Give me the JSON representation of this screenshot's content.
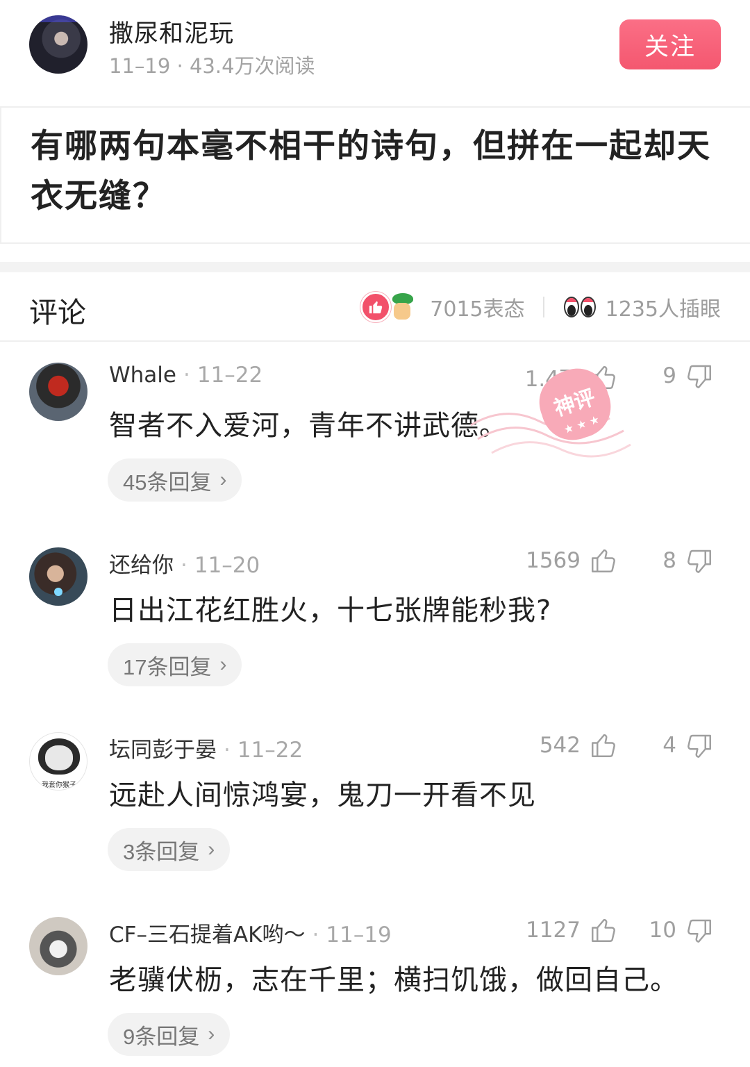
{
  "author": {
    "name": "撒尿和泥玩",
    "meta": "11–19 · 43.4万次阅读",
    "follow_label": "关注"
  },
  "question": {
    "title": "有哪两句本毫不相干的诗句，但拼在一起却天衣无缝？"
  },
  "comments_header": {
    "title": "评论",
    "reactions_count": "7015表态",
    "viewers_count": "1235人插眼"
  },
  "comments": [
    {
      "user": "Whale",
      "date": "11–22",
      "likes": "1.4万",
      "dislikes": "9",
      "text": "智者不入爱河，青年不讲武德。",
      "replies": "45条回复",
      "badge": "神评"
    },
    {
      "user": "还给你",
      "date": "11–20",
      "likes": "1569",
      "dislikes": "8",
      "text": "日出江花红胜火，十七张牌能秒我?",
      "replies": "17条回复"
    },
    {
      "user": "坛同彭于晏",
      "date": "11–22",
      "likes": "542",
      "dislikes": "4",
      "text": "远赴人间惊鸿宴，鬼刀一开看不见",
      "replies": "3条回复",
      "avatar_caption": "我套你猴子"
    },
    {
      "user": "CF–三石提着AK哟～",
      "date": "11–19",
      "likes": "1127",
      "dislikes": "10",
      "text": "老骥伏枥，志在千里；横扫饥饿，做回自己。",
      "replies": "9条回复"
    }
  ],
  "colors": {
    "accent": "#f4576f",
    "muted_text": "#a3a3a3",
    "pill_bg": "#f2f2f2"
  },
  "icons": [
    "thumbs-up-icon",
    "thumbs-down-icon",
    "chevron-right-icon",
    "like-reaction-icon",
    "palm-reaction-icon",
    "eyes-icon"
  ]
}
